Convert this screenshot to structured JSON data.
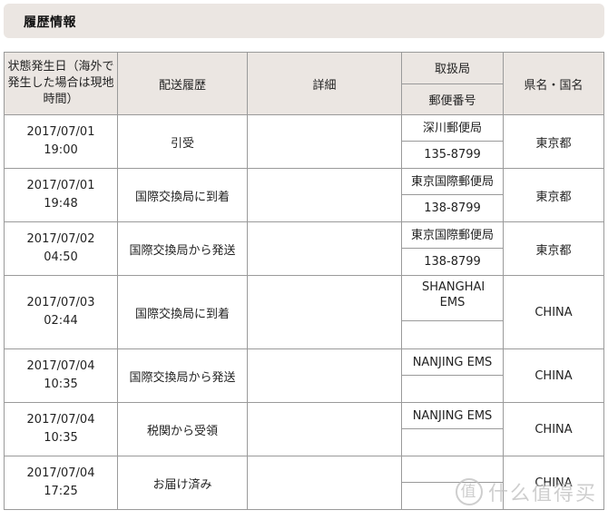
{
  "section": {
    "title": "履歴情報"
  },
  "table": {
    "headers": {
      "date": "状態発生日（海外で発生した場合は現地時間）",
      "status": "配送履歴",
      "detail": "詳細",
      "office": "取扱局",
      "postal": "郵便番号",
      "prefecture": "県名・国名"
    },
    "rows": [
      {
        "date": "2017/07/01",
        "time": "19:00",
        "status": "引受",
        "detail": "",
        "office": "深川郵便局",
        "postal": "135-8799",
        "prefecture": "東京都"
      },
      {
        "date": "2017/07/01",
        "time": "19:48",
        "status": "国際交換局に到着",
        "detail": "",
        "office": "東京国際郵便局",
        "postal": "138-8799",
        "prefecture": "東京都"
      },
      {
        "date": "2017/07/02",
        "time": "04:50",
        "status": "国際交換局から発送",
        "detail": "",
        "office": "東京国際郵便局",
        "postal": "138-8799",
        "prefecture": "東京都"
      },
      {
        "date": "2017/07/03",
        "time": "02:44",
        "status": "国際交換局に到着",
        "detail": "",
        "office": "SHANGHAI EMS",
        "postal": "",
        "prefecture": "CHINA"
      },
      {
        "date": "2017/07/04",
        "time": "10:35",
        "status": "国際交換局から発送",
        "detail": "",
        "office": "NANJING EMS",
        "postal": "",
        "prefecture": "CHINA"
      },
      {
        "date": "2017/07/04",
        "time": "10:35",
        "status": "税関から受領",
        "detail": "",
        "office": "NANJING EMS",
        "postal": "",
        "prefecture": "CHINA"
      },
      {
        "date": "2017/07/04",
        "time": "17:25",
        "status": "お届け済み",
        "detail": "",
        "office": "",
        "postal": "",
        "prefecture": "CHINA"
      }
    ]
  },
  "watermark": {
    "icon": "值",
    "text": "什么值得买"
  }
}
